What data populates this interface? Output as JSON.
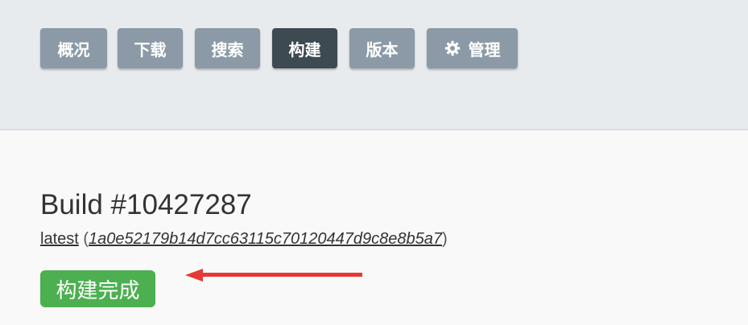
{
  "nav": {
    "items": [
      {
        "label": "概况"
      },
      {
        "label": "下载"
      },
      {
        "label": "搜索"
      },
      {
        "label": "构建"
      },
      {
        "label": "版本"
      },
      {
        "label": "管理",
        "icon": "gear-icon"
      }
    ],
    "active": "构建"
  },
  "build": {
    "title": "Build #10427287",
    "version": "latest",
    "commit": "1a0e52179b14d7cc63115c70120447d9c8e8b5a7",
    "status": "构建完成"
  },
  "colors": {
    "nav_inactive": "#8b9aa6",
    "nav_active": "#3e4a52",
    "status_success": "#4caf50",
    "annotation_arrow": "#e53935"
  }
}
